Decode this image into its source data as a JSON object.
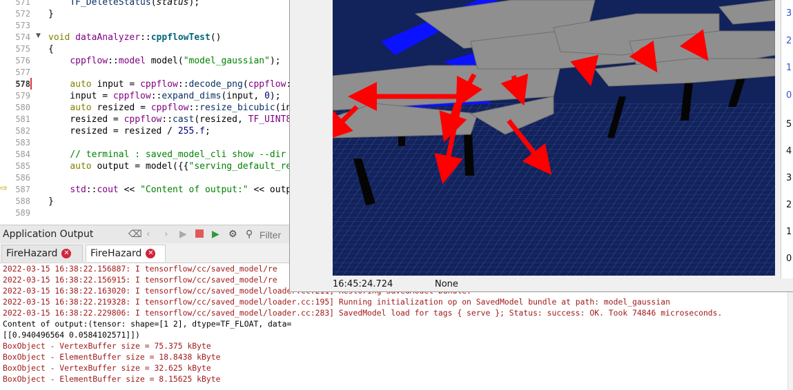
{
  "editor": {
    "current_line": "578",
    "lines": [
      {
        "num": "571",
        "html": "    <span class=\"var\">TF_DeleteStatus</span>(<i>status</i>);"
      },
      {
        "num": "572",
        "html": "}"
      },
      {
        "num": "573",
        "html": ""
      },
      {
        "num": "574",
        "html": "<span class=\"kw\">void</span> <span class=\"ns\">dataAnalyzer</span>::<span class=\"fn\">cppflowTest</span>()"
      },
      {
        "num": "575",
        "html": "{"
      },
      {
        "num": "576",
        "html": "    <span class=\"ns\">cppflow</span>::<span class=\"ns\">model</span> model(<span class=\"str\">\"model_gaussian\"</span>);"
      },
      {
        "num": "577",
        "html": ""
      },
      {
        "num": "578",
        "html": "    <span class=\"kw\">auto</span> input = <span class=\"ns\">cppflow</span>::<span class=\"var\">decode_png</span>(<span class=\"ns\">cppflow</span>:"
      },
      {
        "num": "579",
        "html": "    input = <span class=\"ns\">cppflow</span>::<span class=\"var\">expand_dims</span>(input, <span class=\"num\">0</span>);"
      },
      {
        "num": "580",
        "html": "    <span class=\"kw\">auto</span> resized = <span class=\"ns\">cppflow</span>::<span class=\"var\">resize_bicubic</span>(in"
      },
      {
        "num": "581",
        "html": "    resized = <span class=\"ns\">cppflow</span>::<span class=\"var\">cast</span>(resized, <span class=\"ns\">TF_UINT8</span>"
      },
      {
        "num": "582",
        "html": "    resized = resized / <span class=\"num\">255.f</span>;"
      },
      {
        "num": "583",
        "html": ""
      },
      {
        "num": "584",
        "html": "    <span class=\"cm\">// terminal : saved_model_cli show --dir</span>"
      },
      {
        "num": "585",
        "html": "    <span class=\"kw\">auto</span> output = model({{<span class=\"str\">\"serving_default_re</span>"
      },
      {
        "num": "586",
        "html": ""
      },
      {
        "num": "587",
        "html": "    <span class=\"ns\">std</span>::<span class=\"ns\">cout</span> &lt;&lt; <span class=\"str\">\"Content of output:\"</span> &lt;&lt; outp"
      },
      {
        "num": "588",
        "html": "}"
      },
      {
        "num": "589",
        "html": ""
      }
    ]
  },
  "output_panel": {
    "title": "Application Output",
    "filter_placeholder": "Filter",
    "tabs": [
      {
        "label": "FireHazard",
        "active": false
      },
      {
        "label": "FireHazard",
        "active": true
      }
    ],
    "log": [
      {
        "text": "2022-03-15 16:38:22.156887: I tensorflow/cc/saved_model/re",
        "style": "red"
      },
      {
        "text": "2022-03-15 16:38:22.156915: I tensorflow/cc/saved_model/re",
        "style": "red"
      },
      {
        "text": "2022-03-15 16:38:22.163020: I tensorflow/cc/saved_model/loader.cc:211] Restoring SavedModel bundle.",
        "style": "red"
      },
      {
        "text": "2022-03-15 16:38:22.219328: I tensorflow/cc/saved_model/loader.cc:195] Running initialization op on SavedModel bundle at path: model_gaussian",
        "style": "red"
      },
      {
        "text": "2022-03-15 16:38:22.229806: I tensorflow/cc/saved_model/loader.cc:283] SavedModel load for tags { serve }; Status: success: OK. Took 74846 microseconds.",
        "style": "red"
      },
      {
        "text": "Content of output:(tensor: shape=[1 2], dtype=TF_FLOAT, data=",
        "style": "black"
      },
      {
        "text": "[[0.940496564 0.0584102571]])",
        "style": "black"
      },
      {
        "text": "BoxObject - VertexBuffer size = 75.375 kByte",
        "style": "red"
      },
      {
        "text": "BoxObject - ElementBuffer size = 18.8438 kByte",
        "style": "red"
      },
      {
        "text": "BoxObject - VertexBuffer size = 32.625 kByte",
        "style": "red"
      },
      {
        "text": "BoxObject - ElementBuffer size = 8.15625 kByte",
        "style": "red"
      }
    ]
  },
  "viewer": {
    "status_time": "16:45:24.724",
    "status_selection": "None",
    "axis_ticks_top": [
      "3",
      "2",
      "1",
      "0"
    ],
    "axis_ticks_bottom": [
      "5",
      "4",
      "3",
      "2",
      "1",
      "0"
    ],
    "colors": {
      "ground": "#12225a",
      "grid": "#4b63b8",
      "plate": "#8f8f8f",
      "plate_edge": "#6e6e6e",
      "water": "#0a12ff",
      "arrow": "#ff0000",
      "pillar": "#050505"
    }
  }
}
